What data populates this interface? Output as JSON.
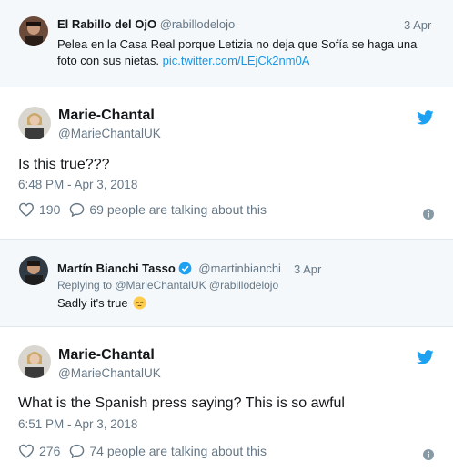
{
  "reply1": {
    "author_name": "El Rabillo del OjO",
    "author_handle": "@rabillodelojo",
    "date": "3 Apr",
    "text": "Pelea en la Casa Real porque Letizia no deja que Sofía se haga una foto con sus nietas.",
    "link": "pic.twitter.com/LEjCk2nm0A"
  },
  "tweet1": {
    "author_name": "Marie-Chantal",
    "author_handle": "@MarieChantalUK",
    "text": "Is this true???",
    "timestamp": "6:48 PM - Apr 3, 2018",
    "likes": "190",
    "talking": "69 people are talking about this"
  },
  "reply2": {
    "author_name": "Martín Bianchi Tasso",
    "author_handle": "@martinbianchi",
    "date": "3 Apr",
    "replying_to": "Replying to @MarieChantalUK @rabillodelojo",
    "text": "Sadly it's true",
    "emoji": "😔"
  },
  "tweet2": {
    "author_name": "Marie-Chantal",
    "author_handle": "@MarieChantalUK",
    "text": "What is the Spanish press saying? This is so awful",
    "timestamp": "6:51 PM - Apr 3, 2018",
    "likes": "276",
    "talking": "74 people are talking about this"
  },
  "colors": {
    "link": "#1b95e0",
    "twitter_blue": "#1da1f2",
    "muted": "#657786",
    "reply_bg": "#f5f8fa"
  }
}
